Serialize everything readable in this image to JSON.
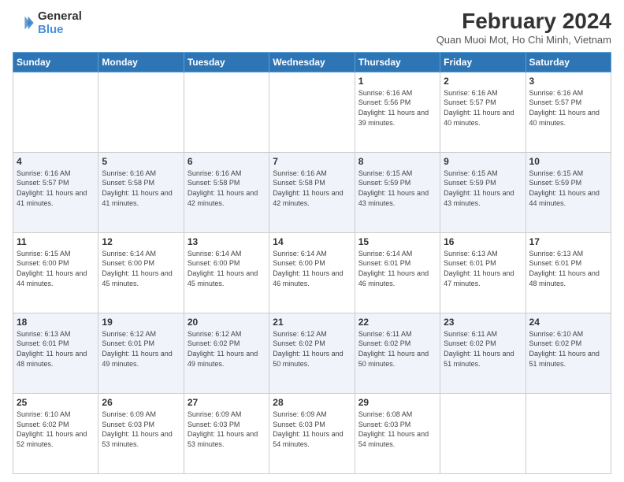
{
  "logo": {
    "line1": "General",
    "line2": "Blue"
  },
  "title": "February 2024",
  "subtitle": "Quan Muoi Mot, Ho Chi Minh, Vietnam",
  "days_of_week": [
    "Sunday",
    "Monday",
    "Tuesday",
    "Wednesday",
    "Thursday",
    "Friday",
    "Saturday"
  ],
  "weeks": [
    [
      {
        "day": "",
        "info": ""
      },
      {
        "day": "",
        "info": ""
      },
      {
        "day": "",
        "info": ""
      },
      {
        "day": "",
        "info": ""
      },
      {
        "day": "1",
        "info": "Sunrise: 6:16 AM\nSunset: 5:56 PM\nDaylight: 11 hours and 39 minutes."
      },
      {
        "day": "2",
        "info": "Sunrise: 6:16 AM\nSunset: 5:57 PM\nDaylight: 11 hours and 40 minutes."
      },
      {
        "day": "3",
        "info": "Sunrise: 6:16 AM\nSunset: 5:57 PM\nDaylight: 11 hours and 40 minutes."
      }
    ],
    [
      {
        "day": "4",
        "info": "Sunrise: 6:16 AM\nSunset: 5:57 PM\nDaylight: 11 hours and 41 minutes."
      },
      {
        "day": "5",
        "info": "Sunrise: 6:16 AM\nSunset: 5:58 PM\nDaylight: 11 hours and 41 minutes."
      },
      {
        "day": "6",
        "info": "Sunrise: 6:16 AM\nSunset: 5:58 PM\nDaylight: 11 hours and 42 minutes."
      },
      {
        "day": "7",
        "info": "Sunrise: 6:16 AM\nSunset: 5:58 PM\nDaylight: 11 hours and 42 minutes."
      },
      {
        "day": "8",
        "info": "Sunrise: 6:15 AM\nSunset: 5:59 PM\nDaylight: 11 hours and 43 minutes."
      },
      {
        "day": "9",
        "info": "Sunrise: 6:15 AM\nSunset: 5:59 PM\nDaylight: 11 hours and 43 minutes."
      },
      {
        "day": "10",
        "info": "Sunrise: 6:15 AM\nSunset: 5:59 PM\nDaylight: 11 hours and 44 minutes."
      }
    ],
    [
      {
        "day": "11",
        "info": "Sunrise: 6:15 AM\nSunset: 6:00 PM\nDaylight: 11 hours and 44 minutes."
      },
      {
        "day": "12",
        "info": "Sunrise: 6:14 AM\nSunset: 6:00 PM\nDaylight: 11 hours and 45 minutes."
      },
      {
        "day": "13",
        "info": "Sunrise: 6:14 AM\nSunset: 6:00 PM\nDaylight: 11 hours and 45 minutes."
      },
      {
        "day": "14",
        "info": "Sunrise: 6:14 AM\nSunset: 6:00 PM\nDaylight: 11 hours and 46 minutes."
      },
      {
        "day": "15",
        "info": "Sunrise: 6:14 AM\nSunset: 6:01 PM\nDaylight: 11 hours and 46 minutes."
      },
      {
        "day": "16",
        "info": "Sunrise: 6:13 AM\nSunset: 6:01 PM\nDaylight: 11 hours and 47 minutes."
      },
      {
        "day": "17",
        "info": "Sunrise: 6:13 AM\nSunset: 6:01 PM\nDaylight: 11 hours and 48 minutes."
      }
    ],
    [
      {
        "day": "18",
        "info": "Sunrise: 6:13 AM\nSunset: 6:01 PM\nDaylight: 11 hours and 48 minutes."
      },
      {
        "day": "19",
        "info": "Sunrise: 6:12 AM\nSunset: 6:01 PM\nDaylight: 11 hours and 49 minutes."
      },
      {
        "day": "20",
        "info": "Sunrise: 6:12 AM\nSunset: 6:02 PM\nDaylight: 11 hours and 49 minutes."
      },
      {
        "day": "21",
        "info": "Sunrise: 6:12 AM\nSunset: 6:02 PM\nDaylight: 11 hours and 50 minutes."
      },
      {
        "day": "22",
        "info": "Sunrise: 6:11 AM\nSunset: 6:02 PM\nDaylight: 11 hours and 50 minutes."
      },
      {
        "day": "23",
        "info": "Sunrise: 6:11 AM\nSunset: 6:02 PM\nDaylight: 11 hours and 51 minutes."
      },
      {
        "day": "24",
        "info": "Sunrise: 6:10 AM\nSunset: 6:02 PM\nDaylight: 11 hours and 51 minutes."
      }
    ],
    [
      {
        "day": "25",
        "info": "Sunrise: 6:10 AM\nSunset: 6:02 PM\nDaylight: 11 hours and 52 minutes."
      },
      {
        "day": "26",
        "info": "Sunrise: 6:09 AM\nSunset: 6:03 PM\nDaylight: 11 hours and 53 minutes."
      },
      {
        "day": "27",
        "info": "Sunrise: 6:09 AM\nSunset: 6:03 PM\nDaylight: 11 hours and 53 minutes."
      },
      {
        "day": "28",
        "info": "Sunrise: 6:09 AM\nSunset: 6:03 PM\nDaylight: 11 hours and 54 minutes."
      },
      {
        "day": "29",
        "info": "Sunrise: 6:08 AM\nSunset: 6:03 PM\nDaylight: 11 hours and 54 minutes."
      },
      {
        "day": "",
        "info": ""
      },
      {
        "day": "",
        "info": ""
      }
    ]
  ]
}
